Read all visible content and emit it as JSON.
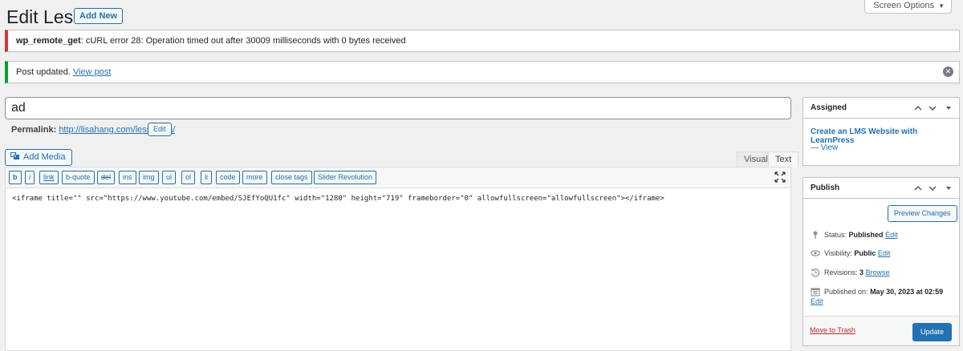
{
  "header": {
    "title": "Edit Lesson",
    "add_new_label": "Add New",
    "screen_options_label": "Screen Options"
  },
  "notices": {
    "error_code": "wp_remote_get",
    "error_message": ": cURL error 28: Operation timed out after 30009 milliseconds with 0 bytes received",
    "success_message": "Post updated.",
    "success_link": "View post"
  },
  "post": {
    "title_value": "ad",
    "permalink_label": "Permalink:",
    "permalink_url": "http://lisahang.com/lessons/a/",
    "edit_slug_label": "Edit"
  },
  "editor": {
    "add_media_label": "Add Media",
    "tab_visual": "Visual",
    "tab_text": "Text",
    "quicktags": [
      "b",
      "i",
      "link",
      "b-quote",
      "del",
      "ins",
      "img",
      "ul",
      "ol",
      "li",
      "code",
      "more",
      "close tags",
      "Slider Revolution"
    ],
    "content": "<iframe title=\"\" src=\"https://www.youtube.com/embed/SJEfYoQU1fc\" width=\"1280\" height=\"719\" frameborder=\"0\" allowfullscreen=\"allowfullscreen\"></iframe>"
  },
  "assigned": {
    "title": "Assigned",
    "course_link": "Create an LMS Website with LearnPress",
    "view_prefix": "— ",
    "view_link": "View"
  },
  "publish": {
    "title": "Publish",
    "preview_label": "Preview Changes",
    "status_label": "Status:",
    "status_value": "Published",
    "status_edit": "Edit",
    "visibility_label": "Visibility:",
    "visibility_value": "Public",
    "visibility_edit": "Edit",
    "revisions_label": "Revisions:",
    "revisions_value": "3",
    "revisions_browse": "Browse",
    "published_on_label": "Published on:",
    "published_on_value": "May 30, 2023 at 02:59",
    "published_on_edit": "Edit",
    "trash_label": "Move to Trash",
    "update_label": "Update"
  },
  "colors": {
    "accent": "#2271b1",
    "error": "#d63638",
    "success": "#00a32a",
    "trash": "#b32d2e"
  }
}
